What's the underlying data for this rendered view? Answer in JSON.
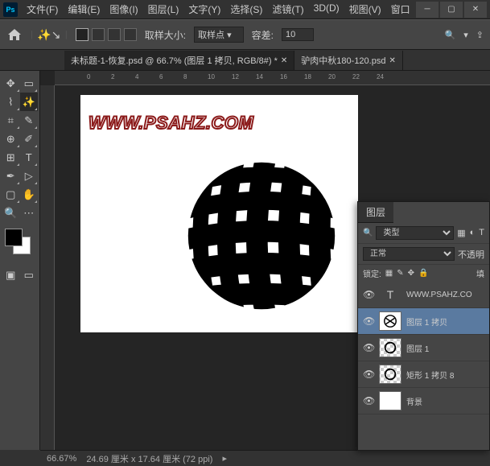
{
  "menu": [
    "文件(F)",
    "编辑(E)",
    "图像(I)",
    "图层(L)",
    "文字(Y)",
    "选择(S)",
    "滤镜(T)",
    "3D(D)",
    "视图(V)",
    "窗口"
  ],
  "options": {
    "sample_size_label": "取样大小:",
    "sample_size_value": "取样点",
    "tolerance_label": "容差:",
    "tolerance_value": "10"
  },
  "tabs": [
    {
      "title": "未标题-1-恢复.psd @ 66.7% (图层 1 拷贝, RGB/8#) *",
      "active": true
    },
    {
      "title": "驴肉中秋180-120.psd",
      "active": false
    }
  ],
  "ruler_marks": [
    "0",
    "2",
    "4",
    "6",
    "8",
    "10",
    "12",
    "14",
    "16",
    "18",
    "20",
    "22",
    "24"
  ],
  "canvas": {
    "watermark": "WWW.PSAHZ.COM"
  },
  "status": {
    "zoom": "66.67%",
    "dimensions": "24.69 厘米 x 17.64 厘米 (72 ppi)"
  },
  "layers_panel": {
    "title": "图层",
    "kind_label": "类型",
    "search_ph": "",
    "blend_mode": "正常",
    "opacity_label": "不透明",
    "lock_label": "锁定:",
    "fill_label": "填",
    "layers": [
      {
        "type": "T",
        "name": "WWW.PSAHZ.CO",
        "thumb": "T"
      },
      {
        "type": "img",
        "name": "图层 1 拷贝",
        "thumb": "sphere",
        "selected": true
      },
      {
        "type": "img",
        "name": "图层 1",
        "thumb": "sphere-checker"
      },
      {
        "type": "img",
        "name": "矩形 1 拷贝 8",
        "thumb": "sphere-checker"
      },
      {
        "type": "img",
        "name": "背景",
        "thumb": "white"
      }
    ]
  }
}
